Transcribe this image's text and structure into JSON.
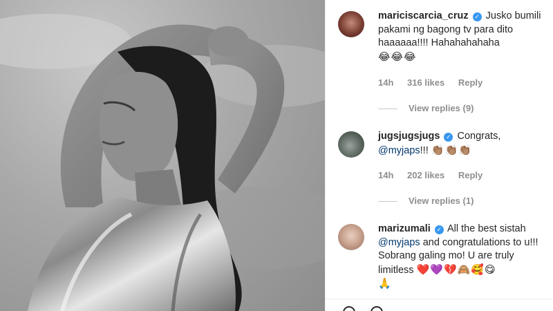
{
  "comments": [
    {
      "username": "mariciscarcia_cruz",
      "text": "Jusko bumili pakami ng bagong tv para dito haaaaaa!!!! Hahahahahaha",
      "emojis": "😂😂😂",
      "time": "14h",
      "likes": "316 likes",
      "reply": "Reply",
      "view_replies": "View replies (9)"
    },
    {
      "username": "jugsjugsjugs",
      "text_before": "Congrats,",
      "mention": "@myjaps",
      "text_after": "!!!",
      "emojis": "👏🏽👏🏽👏🏽",
      "time": "14h",
      "likes": "202 likes",
      "reply": "Reply",
      "view_replies": "View replies (1)"
    },
    {
      "username": "marizumali",
      "text_before": "All the best sistah",
      "mention": "@myjaps",
      "text_after": "and congratulations to u!!! Sobrang galing mo! U are truly limitless",
      "emojis": "❤️💜💔🙈🥰😋",
      "emoji_line2": "🙏"
    }
  ],
  "icons": {
    "verified": "verified-badge-icon",
    "like": "heart-icon",
    "comment": "comment-icon"
  },
  "colors": {
    "verified": "#3897f0",
    "mention": "#00376b",
    "meta": "#8e8e8e"
  }
}
